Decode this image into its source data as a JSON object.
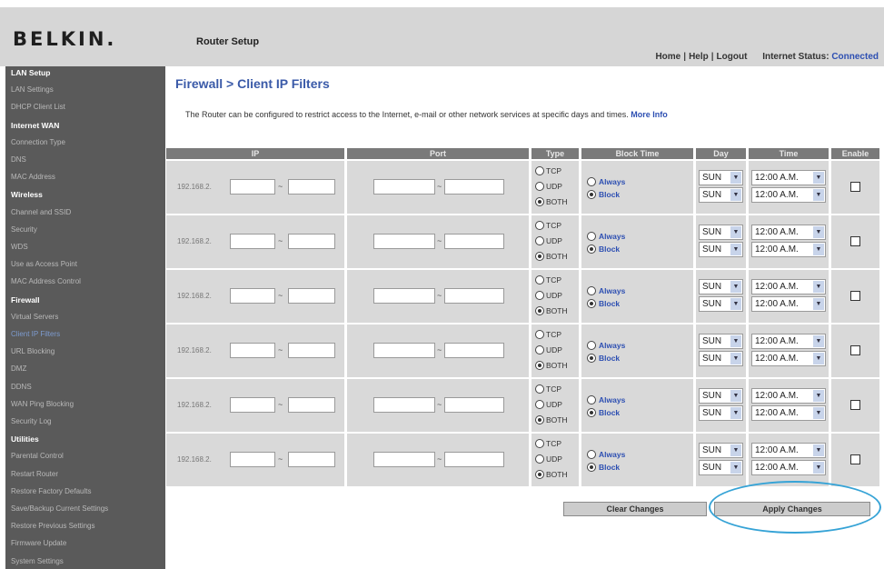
{
  "header": {
    "logo": "BELKIN.",
    "app_title": "Router Setup",
    "links": [
      "Home",
      "Help",
      "Logout"
    ],
    "status_label": "Internet Status:",
    "status_value": "Connected"
  },
  "sidebar": {
    "items": [
      {
        "label": "LAN Setup",
        "kind": "head"
      },
      {
        "label": "LAN Settings",
        "kind": "link"
      },
      {
        "label": "DHCP Client List",
        "kind": "link"
      },
      {
        "label": "Internet WAN",
        "kind": "head"
      },
      {
        "label": "Connection Type",
        "kind": "link"
      },
      {
        "label": "DNS",
        "kind": "link"
      },
      {
        "label": "MAC Address",
        "kind": "link"
      },
      {
        "label": "Wireless",
        "kind": "head"
      },
      {
        "label": "Channel and SSID",
        "kind": "link"
      },
      {
        "label": "Security",
        "kind": "link"
      },
      {
        "label": "WDS",
        "kind": "link"
      },
      {
        "label": "Use as Access Point",
        "kind": "link"
      },
      {
        "label": "MAC Address Control",
        "kind": "link"
      },
      {
        "label": "Firewall",
        "kind": "head"
      },
      {
        "label": "Virtual Servers",
        "kind": "link"
      },
      {
        "label": "Client IP Filters",
        "kind": "current"
      },
      {
        "label": "URL Blocking",
        "kind": "link"
      },
      {
        "label": "DMZ",
        "kind": "link"
      },
      {
        "label": "DDNS",
        "kind": "link"
      },
      {
        "label": "WAN Ping Blocking",
        "kind": "link"
      },
      {
        "label": "Security Log",
        "kind": "link"
      },
      {
        "label": "Utilities",
        "kind": "head"
      },
      {
        "label": "Parental Control",
        "kind": "link"
      },
      {
        "label": "Restart Router",
        "kind": "link"
      },
      {
        "label": "Restore Factory Defaults",
        "kind": "link"
      },
      {
        "label": "Save/Backup Current Settings",
        "kind": "link"
      },
      {
        "label": "Restore Previous Settings",
        "kind": "link"
      },
      {
        "label": "Firmware Update",
        "kind": "link"
      },
      {
        "label": "System Settings",
        "kind": "link"
      }
    ]
  },
  "page": {
    "title": "Firewall > Client IP Filters",
    "description": "The Router can be configured to restrict access to the Internet, e-mail or other network services at specific days and times.",
    "more_info": "More Info"
  },
  "table": {
    "headers": [
      "IP",
      "Port",
      "Type",
      "Block Time",
      "Day",
      "Time",
      "Enable"
    ],
    "ip_prefix": "192.168.2.",
    "range_separator": "~",
    "type_options": [
      "TCP",
      "UDP",
      "BOTH"
    ],
    "block_options": [
      "Always",
      "Block"
    ],
    "rows": [
      {
        "type": "BOTH",
        "block": "Block",
        "day_from": "SUN",
        "day_to": "SUN",
        "time_from": "12:00 A.M.",
        "time_to": "12:00 A.M.",
        "enabled": false
      },
      {
        "type": "BOTH",
        "block": "Block",
        "day_from": "SUN",
        "day_to": "SUN",
        "time_from": "12:00 A.M.",
        "time_to": "12:00 A.M.",
        "enabled": false
      },
      {
        "type": "BOTH",
        "block": "Block",
        "day_from": "SUN",
        "day_to": "SUN",
        "time_from": "12:00 A.M.",
        "time_to": "12:00 A.M.",
        "enabled": false
      },
      {
        "type": "BOTH",
        "block": "Block",
        "day_from": "SUN",
        "day_to": "SUN",
        "time_from": "12:00 A.M.",
        "time_to": "12:00 A.M.",
        "enabled": false
      },
      {
        "type": "BOTH",
        "block": "Block",
        "day_from": "SUN",
        "day_to": "SUN",
        "time_from": "12:00 A.M.",
        "time_to": "12:00 A.M.",
        "enabled": false
      },
      {
        "type": "BOTH",
        "block": "Block",
        "day_from": "SUN",
        "day_to": "SUN",
        "time_from": "12:00 A.M.",
        "time_to": "12:00 A.M.",
        "enabled": false
      }
    ]
  },
  "buttons": {
    "clear": "Clear Changes",
    "apply": "Apply Changes"
  },
  "colors": {
    "sidebar_bg": "#5a5a5a",
    "header_band": "#d6d6d6",
    "title_blue": "#3a5aa8",
    "highlight_oval": "#36a3d6"
  }
}
